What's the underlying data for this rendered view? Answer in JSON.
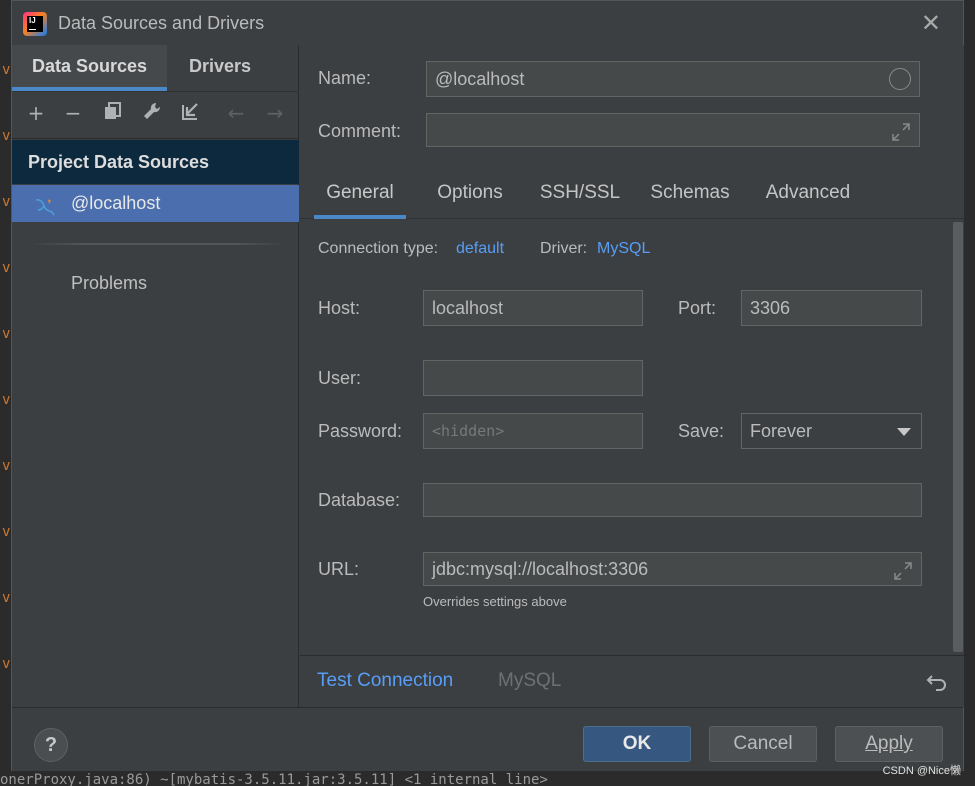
{
  "window": {
    "title": "Data Sources and Drivers"
  },
  "left": {
    "tabs": [
      {
        "label": "Data Sources"
      },
      {
        "label": "Drivers"
      }
    ],
    "section_header": "Project Data Sources",
    "items": [
      {
        "label": "@localhost"
      }
    ],
    "problems_label": "Problems"
  },
  "form": {
    "name_label": "Name:",
    "name_value": "@localhost",
    "comment_label": "Comment:",
    "comment_value": "",
    "tabs": [
      {
        "label": "General"
      },
      {
        "label": "Options"
      },
      {
        "label": "SSH/SSL"
      },
      {
        "label": "Schemas"
      },
      {
        "label": "Advanced"
      }
    ],
    "connection_type_label": "Connection type:",
    "connection_type_value": "default",
    "driver_label": "Driver:",
    "driver_value": "MySQL",
    "host_label": "Host:",
    "host_value": "localhost",
    "port_label": "Port:",
    "port_value": "3306",
    "user_label": "User:",
    "user_value": "",
    "password_label": "Password:",
    "password_placeholder": "<hidden>",
    "save_label": "Save:",
    "save_value": "Forever",
    "database_label": "Database:",
    "database_value": "",
    "url_label": "URL:",
    "url_value": "jdbc:mysql://localhost:3306",
    "url_note": "Overrides settings above",
    "test_connection": "Test Connection",
    "driver_footer": "MySQL"
  },
  "buttons": {
    "help": "?",
    "ok": "OK",
    "cancel": "Cancel",
    "apply": "Apply"
  },
  "background": {
    "gutter_marks": [
      "v",
      "v",
      "v",
      "v",
      "v",
      "v",
      "v",
      "v",
      "v",
      "v"
    ],
    "bottom_code": "onerProxy.java:86) ~[mybatis-3.5.11.jar:3.5.11] <1 internal line>"
  },
  "watermark": "CSDN @Nice懒",
  "colors": {
    "accent": "#4a88c7",
    "selection": "#4b6eaf",
    "link": "#589df6",
    "header_bg": "#0d293e",
    "ok_button": "#365880"
  }
}
